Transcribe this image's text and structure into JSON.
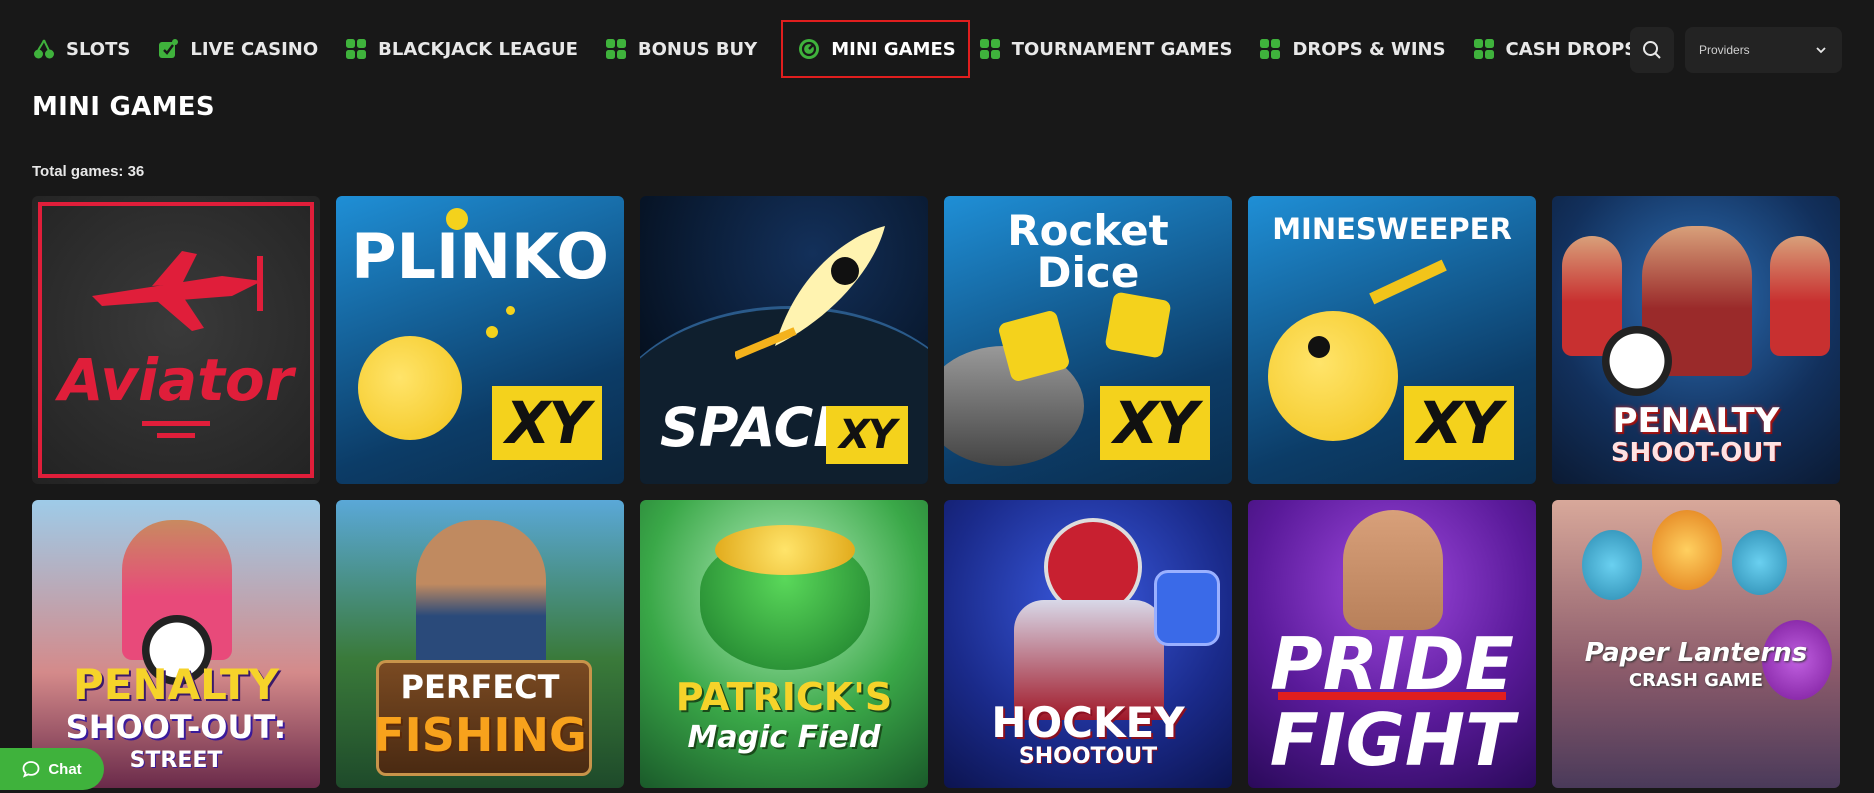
{
  "nav": {
    "items": [
      {
        "label": "SLOTS",
        "icon": "cherry-icon"
      },
      {
        "label": "LIVE CASINO",
        "icon": "chip-icon"
      },
      {
        "label": "BLACKJACK LEAGUE",
        "icon": "grid-icon"
      },
      {
        "label": "BONUS BUY",
        "icon": "grid-icon"
      },
      {
        "label": "MINI GAMES",
        "icon": "mini-games-icon"
      },
      {
        "label": "TOURNAMENT GAMES",
        "icon": "grid-icon"
      },
      {
        "label": "DROPS & WINS",
        "icon": "grid-icon"
      },
      {
        "label": "CASH DROPS",
        "icon": "grid-icon"
      }
    ],
    "active": "MINI GAMES"
  },
  "providers": {
    "label": "Providers"
  },
  "page": {
    "title": "MINI GAMES",
    "total": "Total games: 36"
  },
  "games": [
    {
      "title": "Aviator"
    },
    {
      "title": "PLINKO",
      "badge": "XY"
    },
    {
      "title": "SPACE",
      "badge": "XY"
    },
    {
      "title": "Rocket Dice",
      "line1": "Rocket",
      "line2": "Dice",
      "badge": "XY"
    },
    {
      "title": "MINESWEEPER",
      "badge": "XY"
    },
    {
      "title": "PENALTY SHOOT-OUT",
      "line1": "PENALTY",
      "line2": "SHOOT-OUT"
    },
    {
      "title": "PENALTY SHOOT-OUT: STREET",
      "line1": "PENALTY",
      "line2": "SHOOT-OUT:",
      "line3": "STREET"
    },
    {
      "title": "PERFECT FISHING",
      "line1": "PERFECT",
      "line2": "FISHING"
    },
    {
      "title": "PATRICK'S Magic Field",
      "line1": "PATRICK'S",
      "line2": "Magic Field"
    },
    {
      "title": "HOCKEY SHOOTOUT",
      "line1": "HOCKEY",
      "line2": "SHOOTOUT"
    },
    {
      "title": "PRIDE FIGHT",
      "line1": "PRIDE",
      "line2": "FIGHT"
    },
    {
      "title": "Paper Lanterns CRASH GAME",
      "line1": "Paper Lanterns",
      "line2": "CRASH GAME"
    }
  ],
  "chat": {
    "label": "Chat"
  },
  "colors": {
    "accent_green": "#3fb23c",
    "active_border": "#e01e1e",
    "xy_yellow": "#f4d21c",
    "background": "#181818"
  }
}
